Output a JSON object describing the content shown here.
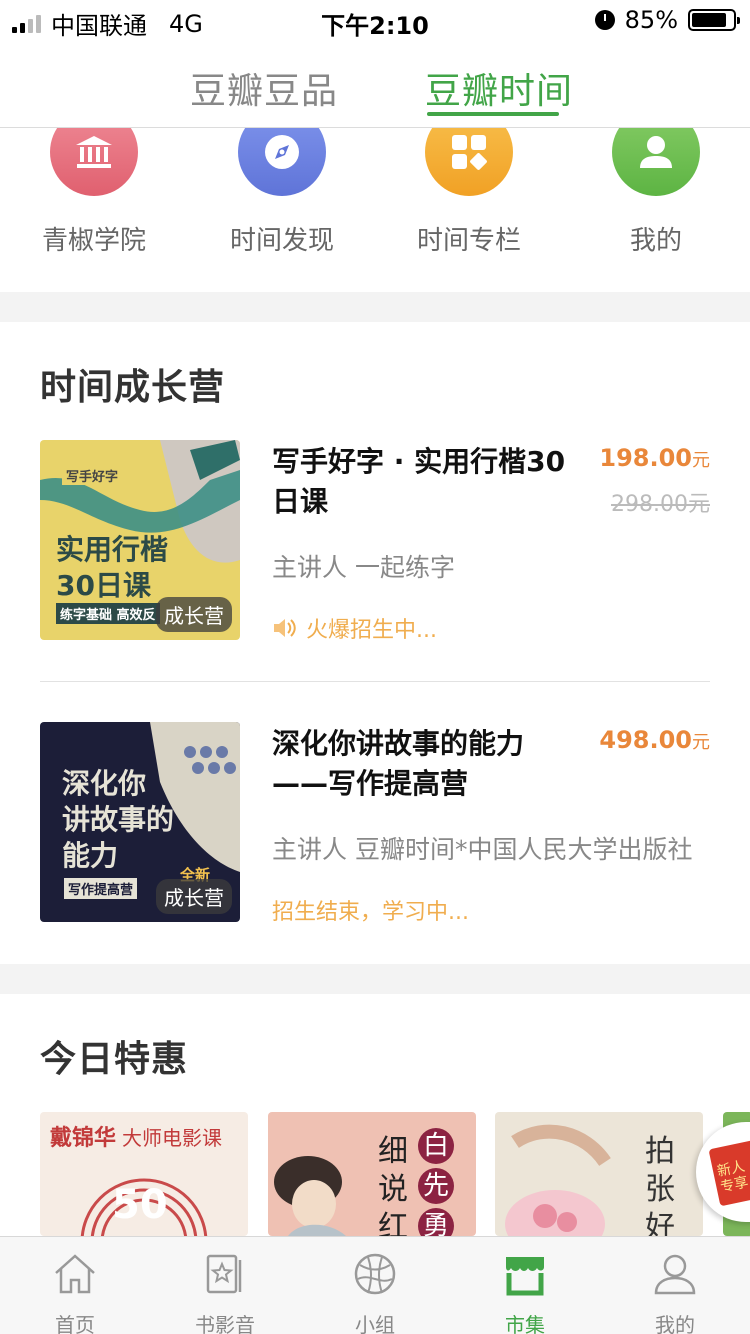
{
  "status_bar": {
    "carrier": "中国联通",
    "network": "4G",
    "time": "下午2:10",
    "battery": "85%"
  },
  "top_tabs": [
    {
      "label": "豆瓣豆品",
      "active": false
    },
    {
      "label": "豆瓣时间",
      "active": true
    }
  ],
  "quick_nav": [
    {
      "label": "青椒学院",
      "icon": "institution-icon"
    },
    {
      "label": "时间发现",
      "icon": "compass-icon"
    },
    {
      "label": "时间专栏",
      "icon": "grid-icon"
    },
    {
      "label": "我的",
      "icon": "user-icon"
    }
  ],
  "growth_camp": {
    "title": "时间成长营",
    "courses": [
      {
        "title": "写手好字 · 实用行楷30日课",
        "price": "198.00",
        "currency": "元",
        "old_price": "298.00元",
        "lecturer": "主讲人 一起练字",
        "status": "火爆招生中...",
        "tag": "成长营",
        "cover_lines": [
          "写手好字",
          "实用行楷",
          "30日课",
          "练字基础 高效反"
        ]
      },
      {
        "title": "深化你讲故事的能力——写作提高营",
        "price": "498.00",
        "currency": "元",
        "old_price": "",
        "lecturer": "主讲人 豆瓣时间*中国人民大学出版社",
        "status": "招生结束，学习中...",
        "tag": "成长营",
        "cover_lines": [
          "深化你",
          "讲故事的",
          "能力",
          "写作提高营",
          "全新"
        ]
      }
    ]
  },
  "daily_deals": {
    "title": "今日特惠",
    "items": [
      {
        "text_a": "戴锦华",
        "text_b": "大师电影课",
        "text_c": "50"
      },
      {
        "text_a": "细",
        "text_b": "说",
        "text_c": "红",
        "text_d": "白",
        "text_e": "先",
        "text_f": "勇"
      },
      {
        "text_a": "拍",
        "text_b": "张",
        "text_c": "好"
      }
    ],
    "badge_lines": [
      "新人",
      "专享"
    ]
  },
  "tab_bar": [
    {
      "label": "首页",
      "icon": "home-icon",
      "active": false
    },
    {
      "label": "书影音",
      "icon": "book-movie-icon",
      "active": false
    },
    {
      "label": "小组",
      "icon": "group-icon",
      "active": false
    },
    {
      "label": "市集",
      "icon": "market-icon",
      "active": true
    },
    {
      "label": "我的",
      "icon": "profile-icon",
      "active": false
    }
  ],
  "colors": {
    "brand_green": "#42a548",
    "price_orange": "#e9873a",
    "status_yellow": "#f0ad4e"
  }
}
